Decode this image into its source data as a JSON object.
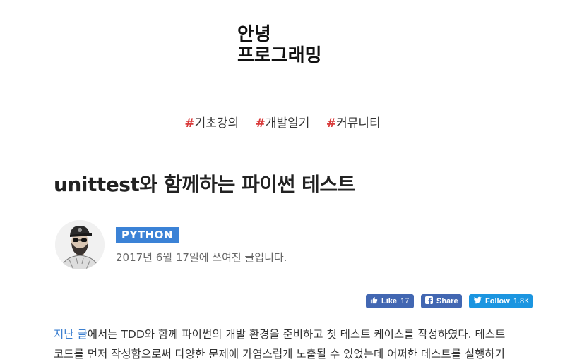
{
  "site": {
    "logo_line1": "안녕",
    "logo_line2": "프로그래밍"
  },
  "nav": {
    "items": [
      {
        "hash": "#",
        "label": "기초강의"
      },
      {
        "hash": "#",
        "label": "개발일기"
      },
      {
        "hash": "#",
        "label": "커뮤니티"
      }
    ]
  },
  "post": {
    "title": "unittest와 함께하는 파이썬 테스트",
    "tag": "PYTHON",
    "date": "2017년 6월 17일에 쓰여진 글입니다."
  },
  "social": {
    "like_label": "Like",
    "like_count": "17",
    "share_label": "Share",
    "follow_label": "Follow",
    "follow_count": "1.8K"
  },
  "content": {
    "link_text": "지난 글",
    "line1_rest": "에서는 TDD와 함께 파이썬의 개발 환경을 준비하고 첫 테스트 케이스를 작성하였다. 테스트",
    "line2": "코드를 먼저 작성함으로써 다양한 문제에 가염스럽게 노출될 수 있었는데 어쩌한 테스트를 실행하기"
  },
  "colors": {
    "accent_red": "#d93a3a",
    "tag_blue": "#3b82d6",
    "facebook": "#4267b2",
    "twitter": "#1b95e0",
    "link": "#3b7fd0"
  }
}
